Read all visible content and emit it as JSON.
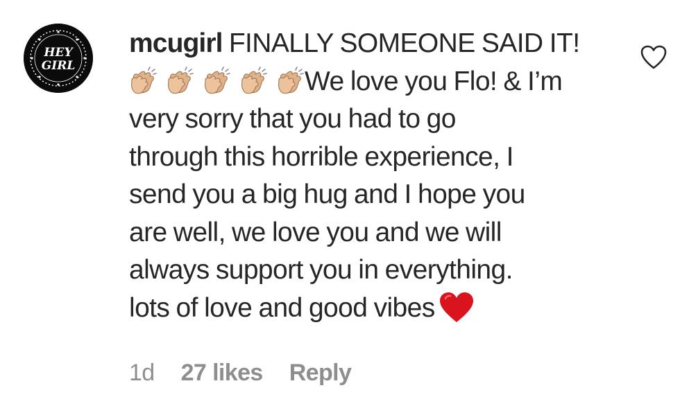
{
  "comment": {
    "avatar": {
      "logo_text_top": "HEY",
      "logo_text_bottom": "GIRL",
      "background_color": "#0b0b0b"
    },
    "username": "mcugirl",
    "text_first_line": "FINALLY SOMEONE SAID IT!",
    "emoji_run": {
      "icon": "clapping-hands-medium-light-skin-emoji",
      "count": 5
    },
    "text_after_claps": "We love you Flo! & I’m",
    "lines": [
      "very sorry that you had to go",
      "through this horrible experience, I",
      "send you a big hug and I hope you",
      "are well, we love you and we will",
      "always support you in everything."
    ],
    "last_line": "lots of love and good vibes",
    "end_emoji": "red-heart-emoji",
    "time": "1d",
    "likes": "27 likes",
    "reply_label": "Reply",
    "like_icon": "heart-outline-icon"
  },
  "colors": {
    "text": "#262626",
    "meta": "#8e8e8e",
    "heart": "#d9141f",
    "clap_skin": "#dfb38b",
    "like_outline": "#262626"
  }
}
